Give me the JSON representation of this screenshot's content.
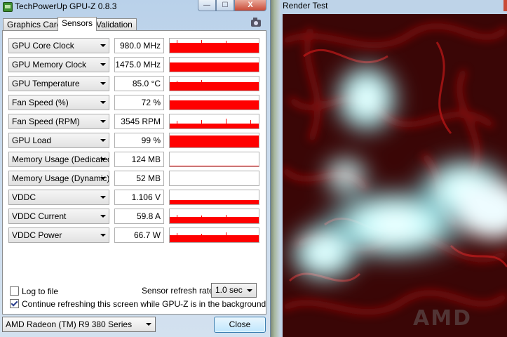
{
  "gpuz": {
    "title": "TechPowerUp GPU-Z 0.8.3",
    "controls": {
      "minimize": "—",
      "maximize": "☐",
      "close": "X"
    },
    "tabs": [
      {
        "label": "Graphics Card",
        "active": false
      },
      {
        "label": "Sensors",
        "active": true
      },
      {
        "label": "Validation",
        "active": false
      }
    ],
    "camera_icon": "camera-icon",
    "sensors": [
      {
        "name": "GPU Core Clock",
        "value": "980.0 MHz",
        "level": 0.7,
        "spikes": [
          0.88,
          0.9,
          0.86
        ]
      },
      {
        "name": "GPU Memory Clock",
        "value": "1475.0 MHz",
        "level": 0.65,
        "spikes": []
      },
      {
        "name": "GPU Temperature",
        "value": "85.0 °C",
        "level": 0.62,
        "spikes": [
          0.72,
          0.74
        ]
      },
      {
        "name": "Fan Speed (%)",
        "value": "72 %",
        "level": 0.64,
        "spikes": []
      },
      {
        "name": "Fan Speed (RPM)",
        "value": "3545 RPM",
        "level": 0.35,
        "spikes": [
          0.55,
          0.6,
          0.7,
          0.58
        ]
      },
      {
        "name": "GPU Load",
        "value": "99 %",
        "level": 0.85,
        "spikes": []
      },
      {
        "name": "Memory Usage (Dedicated)",
        "value": "124 MB",
        "level": 0.05,
        "spikes": []
      },
      {
        "name": "Memory Usage (Dynamic)",
        "value": "52 MB",
        "level": 0.0,
        "spikes": []
      },
      {
        "name": "VDDC",
        "value": "1.106 V",
        "level": 0.3,
        "spikes": []
      },
      {
        "name": "VDDC Current",
        "value": "59.8 A",
        "level": 0.45,
        "spikes": [
          0.6,
          0.55,
          0.62
        ]
      },
      {
        "name": "VDDC Power",
        "value": "66.7 W",
        "level": 0.5,
        "spikes": [
          0.65,
          0.6,
          0.68
        ]
      }
    ],
    "log_to_file": {
      "label": "Log to file",
      "checked": false
    },
    "continue_refreshing": {
      "label": "Continue refreshing this screen while GPU-Z is in the background",
      "checked": true
    },
    "refresh_rate": {
      "label": "Sensor refresh rate:",
      "value": "1.0 sec"
    },
    "gpu_select": "AMD Radeon (TM) R9 380 Series",
    "close_button": "Close",
    "graph_color": "#ff0000"
  },
  "render": {
    "title": "Render Test",
    "watermark": "AMD"
  }
}
